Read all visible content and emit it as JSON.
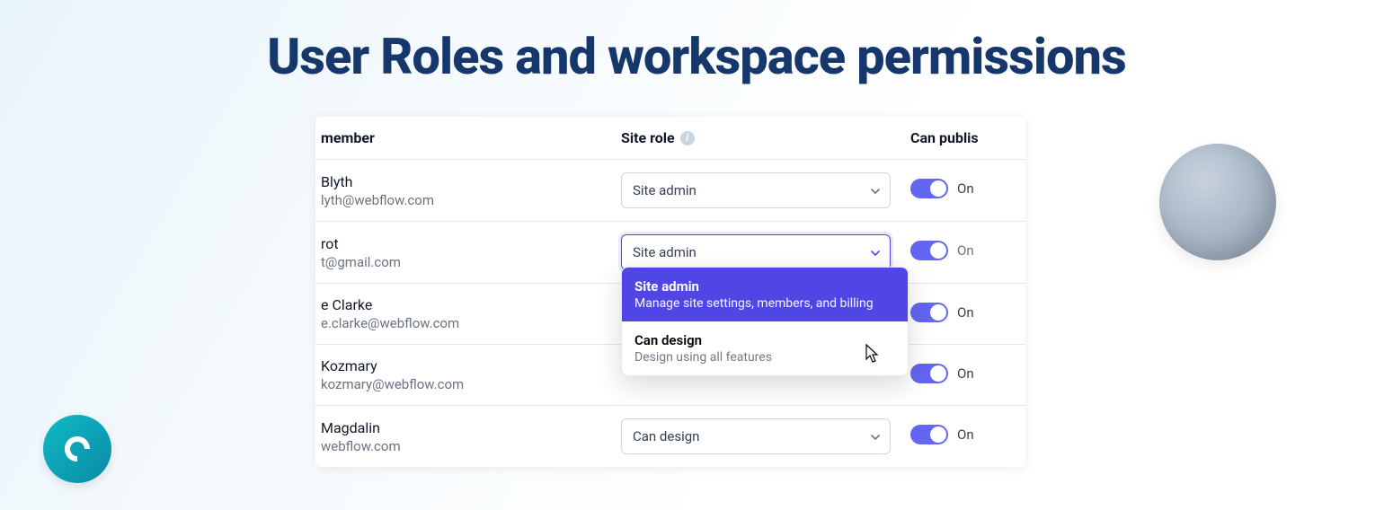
{
  "page": {
    "title": "User Roles and workspace permissions"
  },
  "table": {
    "headers": {
      "member": "member",
      "site_role": "Site role",
      "can_publish": "Can publis"
    },
    "rows": [
      {
        "name": "Blyth",
        "email": "lyth@webflow.com",
        "role": "Site admin",
        "publish": "On",
        "publish_on": true
      },
      {
        "name": "rot",
        "email": "t@gmail.com",
        "role": "Site admin",
        "publish": "On",
        "publish_on": false,
        "focused": true
      },
      {
        "name": "e Clarke",
        "email": "e.clarke@webflow.com",
        "role": "",
        "publish": "On",
        "publish_on": true
      },
      {
        "name": "Kozmary",
        "email": "kozmary@webflow.com",
        "role": "",
        "publish": "On",
        "publish_on": true
      },
      {
        "name": "Magdalin",
        "email": "webflow.com",
        "role": "Can design",
        "publish": "On",
        "publish_on": true
      }
    ]
  },
  "dropdown": {
    "open_on_row": 1,
    "options": [
      {
        "title": "Site admin",
        "desc": "Manage site settings, members, and billing",
        "selected": true
      },
      {
        "title": "Can design",
        "desc": "Design using all features",
        "selected": false
      }
    ]
  },
  "icons": {
    "info": "i"
  }
}
